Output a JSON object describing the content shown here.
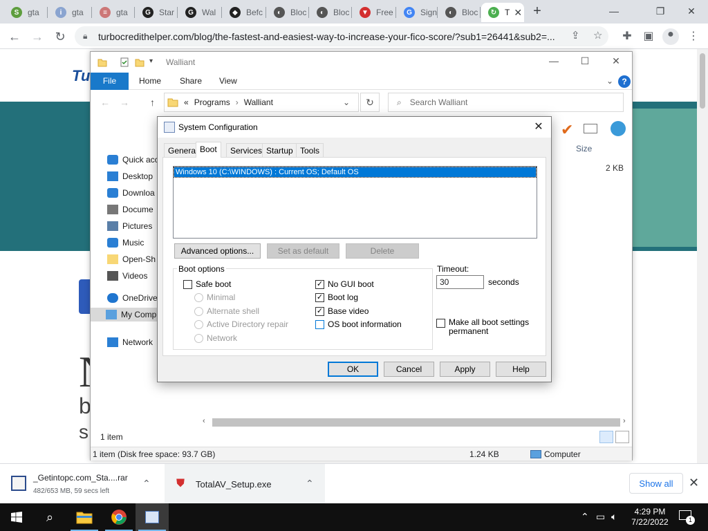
{
  "browser": {
    "tabs": [
      {
        "label": "gta",
        "fav_color": "#5e9e3e",
        "fav": "S"
      },
      {
        "label": "gta",
        "fav_color": "#8aa4d0",
        "fav": "i"
      },
      {
        "label": "gta",
        "fav_color": "#c77",
        "fav": "≡"
      },
      {
        "label": "Star",
        "fav_color": "#222",
        "fav": "G"
      },
      {
        "label": "Wal",
        "fav_color": "#222",
        "fav": "G"
      },
      {
        "label": "Befc",
        "fav_color": "#222",
        "fav": "◆"
      },
      {
        "label": "Bloc",
        "fav_color": "#555",
        "fav": "◐"
      },
      {
        "label": "Bloc",
        "fav_color": "#555",
        "fav": "◐"
      },
      {
        "label": "Free",
        "fav_color": "#d32f2f",
        "fav": "▼"
      },
      {
        "label": "Sign",
        "fav_color": "#4285f4",
        "fav": "G"
      },
      {
        "label": "Bloc",
        "fav_color": "#555",
        "fav": "◐"
      },
      {
        "label": "T",
        "fav_color": "#4caf50",
        "fav": "↻"
      }
    ],
    "new_tab": "+",
    "url": "turbocredithelper.com/blog/the-fastest-and-easiest-way-to-increase-your-fico-score/?sub1=26441&sub2=..."
  },
  "webpage": {
    "logo": "Tu",
    "heading_letter": "N",
    "line2": "b",
    "line3": "s"
  },
  "explorer": {
    "title": "Walliant",
    "ribbon_tabs": [
      "File",
      "Home",
      "Share",
      "View"
    ],
    "breadcrumb_prefix": "«",
    "breadcrumb": [
      "Programs",
      "Walliant"
    ],
    "search_placeholder": "Search Walliant",
    "column_size": "Size",
    "size_value": "2 KB",
    "nav": [
      {
        "label": "Quick acc",
        "icon": "star-icon"
      },
      {
        "label": "Desktop",
        "icon": "desktop-icon"
      },
      {
        "label": "Downloa",
        "icon": "download-icon"
      },
      {
        "label": "Docume",
        "icon": "document-icon"
      },
      {
        "label": "Pictures",
        "icon": "pictures-icon"
      },
      {
        "label": "Music",
        "icon": "music-icon"
      },
      {
        "label": "Open-Sh",
        "icon": "folder-icon"
      },
      {
        "label": "Videos",
        "icon": "videos-icon"
      },
      {
        "label": "OneDrive",
        "icon": "cloud-icon"
      },
      {
        "label": "My Comp",
        "icon": "computer-icon"
      },
      {
        "label": "Network",
        "icon": "network-icon"
      }
    ],
    "item_count": "1 item",
    "status_left": "1 item (Disk free space: 93.7 GB)",
    "status_size": "1.24 KB",
    "status_location": "Computer"
  },
  "msconfig": {
    "title": "System Configuration",
    "tabs": [
      "General",
      "Boot",
      "Services",
      "Startup",
      "Tools"
    ],
    "active_tab": "Boot",
    "os_entry": "Windows 10 (C:\\WINDOWS) : Current OS; Default OS",
    "buttons": {
      "advanced": "Advanced options...",
      "set_default": "Set as default",
      "delete": "Delete"
    },
    "boot_options_label": "Boot options",
    "safe_boot": {
      "label": "Safe boot",
      "checked": false
    },
    "radios": [
      "Minimal",
      "Alternate shell",
      "Active Directory repair",
      "Network"
    ],
    "checks": [
      {
        "label": "No GUI boot",
        "checked": true
      },
      {
        "label": "Boot log",
        "checked": true
      },
      {
        "label": "Base video",
        "checked": true
      },
      {
        "label": "OS boot information",
        "checked": false
      }
    ],
    "timeout_label": "Timeout:",
    "timeout_value": "30",
    "timeout_unit": "seconds",
    "make_permanent": {
      "line1": "Make all boot settings",
      "line2": "permanent",
      "checked": false
    },
    "footer": {
      "ok": "OK",
      "cancel": "Cancel",
      "apply": "Apply",
      "help": "Help"
    }
  },
  "downloads": {
    "items": [
      {
        "name": "_Getintopc.com_Sta....rar",
        "status": "482/653 MB, 59 secs left"
      },
      {
        "name": "TotalAV_Setup.exe",
        "status": ""
      }
    ],
    "show_all": "Show all"
  },
  "taskbar": {
    "time": "4:29 PM",
    "date": "7/22/2022",
    "notification_count": "1"
  }
}
